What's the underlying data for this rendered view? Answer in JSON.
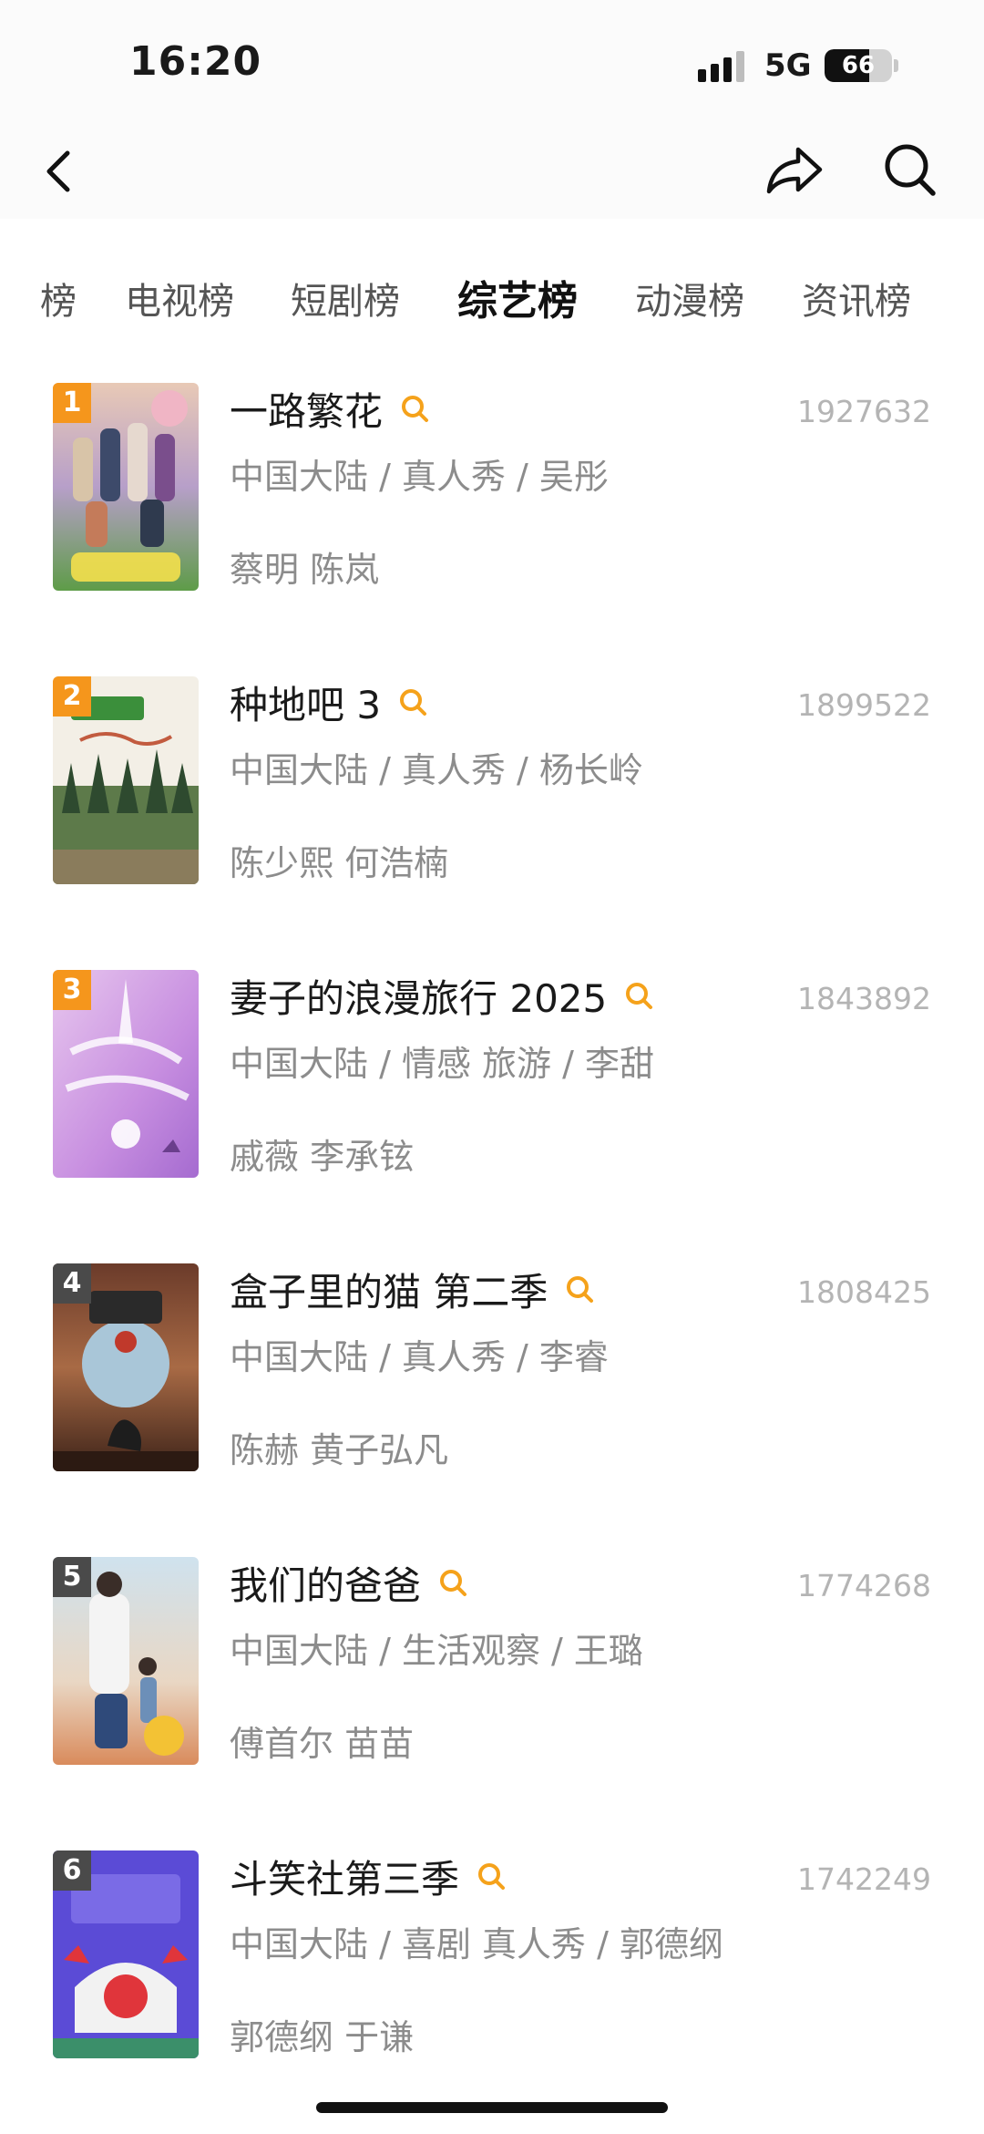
{
  "status_bar": {
    "time": "16:20",
    "network": "5G",
    "battery_percent": 66
  },
  "nav": {
    "back_icon": "chevron-left-icon",
    "share_icon": "share-arrow-icon",
    "search_icon": "search-icon"
  },
  "tabs": [
    {
      "label": "榜",
      "active": false
    },
    {
      "label": "电视榜",
      "active": false
    },
    {
      "label": "短剧榜",
      "active": false
    },
    {
      "label": "综艺榜",
      "active": true
    },
    {
      "label": "动漫榜",
      "active": false
    },
    {
      "label": "资讯榜",
      "active": false
    }
  ],
  "colors": {
    "accent": "#f5a21b",
    "rank_top": "#f5961c",
    "rank_other": "#4a4a4a"
  },
  "items": [
    {
      "rank": "1",
      "title": "一路繁花",
      "count": "1927632",
      "meta": "中国大陆 / 真人秀 / 吴彤",
      "cast": "蔡明 陈岚"
    },
    {
      "rank": "2",
      "title": "种地吧 3",
      "count": "1899522",
      "meta": "中国大陆 / 真人秀 / 杨长岭",
      "cast": "陈少熙 何浩楠"
    },
    {
      "rank": "3",
      "title": "妻子的浪漫旅行 2025",
      "count": "1843892",
      "meta": "中国大陆 / 情感 旅游 / 李甜",
      "cast": "戚薇 李承铉"
    },
    {
      "rank": "4",
      "title": "盒子里的猫 第二季",
      "count": "1808425",
      "meta": "中国大陆 / 真人秀 / 李睿",
      "cast": "陈赫 黄子弘凡"
    },
    {
      "rank": "5",
      "title": "我们的爸爸",
      "count": "1774268",
      "meta": "中国大陆 / 生活观察 / 王璐",
      "cast": "傅首尔 苗苗"
    },
    {
      "rank": "6",
      "title": "斗笑社第三季",
      "count": "1742249",
      "meta": "中国大陆 / 喜剧 真人秀 / 郭德纲",
      "cast": "郭德纲 于谦"
    }
  ]
}
